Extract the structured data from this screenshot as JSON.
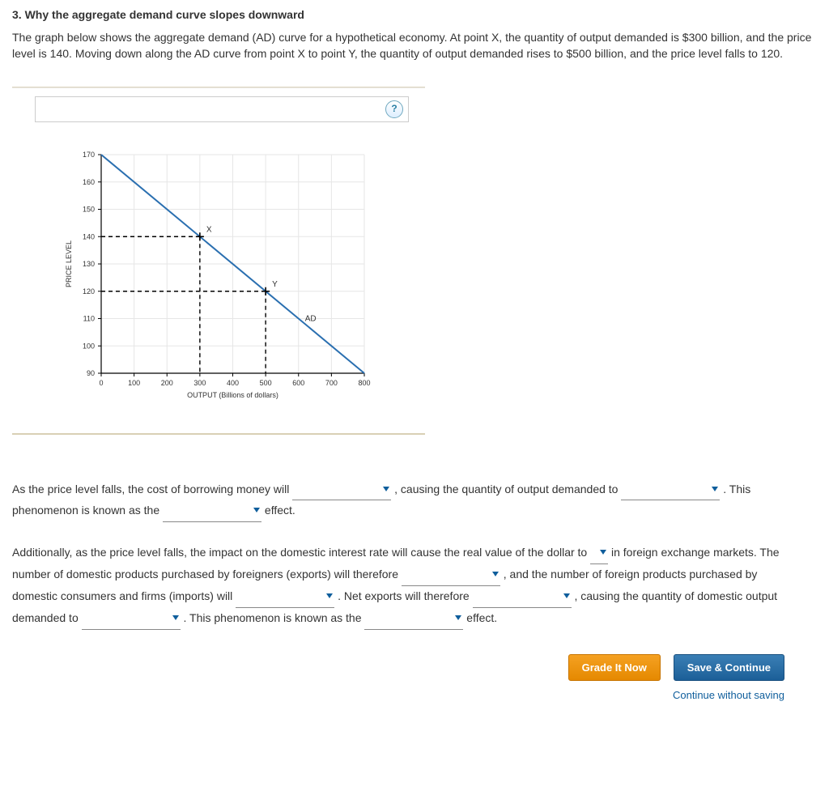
{
  "heading": "3. Why the aggregate demand curve slopes downward",
  "intro": "The graph below shows the aggregate demand (AD) curve for a hypothetical economy. At point X, the quantity of output demanded is $300 billion, and the price level is 140. Moving down along the AD curve from point X to point Y, the quantity of output demanded rises to $500 billion, and the price level falls to 120.",
  "help_label": "?",
  "chart_data": {
    "type": "line",
    "title": "",
    "xlabel": "OUTPUT (Billions of dollars)",
    "ylabel": "PRICE LEVEL",
    "xlim": [
      0,
      800
    ],
    "ylim": [
      90,
      170
    ],
    "x_ticks": [
      0,
      100,
      200,
      300,
      400,
      500,
      600,
      700,
      800
    ],
    "y_ticks": [
      90,
      100,
      110,
      120,
      130,
      140,
      150,
      160,
      170
    ],
    "series": [
      {
        "name": "AD",
        "color": "#2a6fb0",
        "points": [
          [
            0,
            170
          ],
          [
            800,
            90
          ]
        ]
      }
    ],
    "markers": [
      {
        "name": "X",
        "x": 300,
        "y": 140
      },
      {
        "name": "Y",
        "x": 500,
        "y": 120
      }
    ]
  },
  "para1": {
    "t1": "As the price level falls, the cost of borrowing money will ",
    "t2": " , causing the quantity of output demanded to ",
    "t3": " . This phenomenon is known as the ",
    "t4": " effect."
  },
  "para2": {
    "t1": "Additionally, as the price level falls, the impact on the domestic interest rate will cause the real value of the dollar to ",
    "t2": " in foreign exchange markets. The number of domestic products purchased by foreigners (exports) will therefore ",
    "t3": " , and the number of foreign products purchased by domestic consumers and firms (imports) will ",
    "t4": " . Net exports will therefore ",
    "t5": " , causing the quantity of domestic output demanded to ",
    "t6": " . This phenomenon is known as the ",
    "t7": " effect."
  },
  "buttons": {
    "grade": "Grade It Now",
    "save": "Save & Continue",
    "skip": "Continue without saving"
  }
}
